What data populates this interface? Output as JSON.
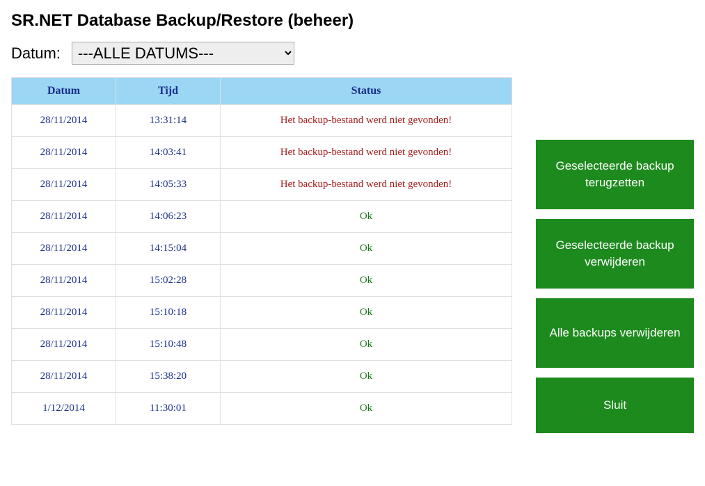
{
  "title": "SR.NET Database Backup/Restore (beheer)",
  "filter": {
    "label": "Datum:",
    "selected": "---ALLE DATUMS---"
  },
  "table": {
    "headers": {
      "date": "Datum",
      "time": "Tijd",
      "status": "Status"
    },
    "rows": [
      {
        "date": "28/11/2014",
        "time": "13:31:14",
        "status": "Het backup-bestand werd niet gevonden!",
        "status_kind": "error"
      },
      {
        "date": "28/11/2014",
        "time": "14:03:41",
        "status": "Het backup-bestand werd niet gevonden!",
        "status_kind": "error"
      },
      {
        "date": "28/11/2014",
        "time": "14:05:33",
        "status": "Het backup-bestand werd niet gevonden!",
        "status_kind": "error"
      },
      {
        "date": "28/11/2014",
        "time": "14:06:23",
        "status": "Ok",
        "status_kind": "ok"
      },
      {
        "date": "28/11/2014",
        "time": "14:15:04",
        "status": "Ok",
        "status_kind": "ok"
      },
      {
        "date": "28/11/2014",
        "time": "15:02:28",
        "status": "Ok",
        "status_kind": "ok"
      },
      {
        "date": "28/11/2014",
        "time": "15:10:18",
        "status": "Ok",
        "status_kind": "ok"
      },
      {
        "date": "28/11/2014",
        "time": "15:10:48",
        "status": "Ok",
        "status_kind": "ok"
      },
      {
        "date": "28/11/2014",
        "time": "15:38:20",
        "status": "Ok",
        "status_kind": "ok"
      },
      {
        "date": "1/12/2014",
        "time": "11:30:01",
        "status": "Ok",
        "status_kind": "ok"
      }
    ]
  },
  "buttons": {
    "restore": "Geselecteerde backup terugzetten",
    "delete_selected": "Geselecteerde backup verwijderen",
    "delete_all": "Alle backups verwijderen",
    "close": "Sluit"
  }
}
